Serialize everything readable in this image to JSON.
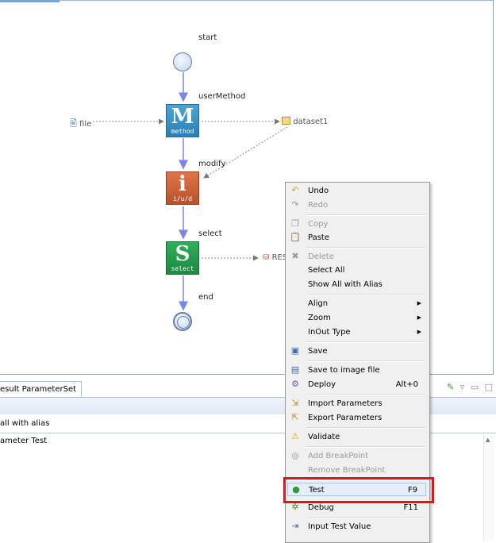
{
  "diagram": {
    "labels": {
      "start": "start",
      "userMethod": "userMethod",
      "modify": "modify",
      "select": "select",
      "end": "end",
      "file": "file",
      "dataset1": "dataset1",
      "res": "RES"
    },
    "nodes": {
      "method": {
        "big": "M",
        "small": "method"
      },
      "iud": {
        "big": "i",
        "small": "i/u/d"
      },
      "select": {
        "big": "S",
        "small": "select"
      }
    }
  },
  "bottom_panel": {
    "tab_label": "esult ParameterSet",
    "row1": "all with alias",
    "row2": "ameter Test"
  },
  "context_menu": {
    "items": [
      {
        "label": "Undo",
        "icon": "undo-icon",
        "disabled": false
      },
      {
        "label": "Redo",
        "icon": "redo-icon",
        "disabled": true
      },
      {
        "label": "Copy",
        "icon": "copy-icon",
        "disabled": true
      },
      {
        "label": "Paste",
        "icon": "paste-icon",
        "disabled": false
      },
      {
        "label": "Delete",
        "icon": "delete-icon",
        "disabled": true
      },
      {
        "label": "Select All",
        "disabled": false
      },
      {
        "label": "Show All with Alias",
        "disabled": false
      },
      {
        "label": "Align",
        "submenu": true
      },
      {
        "label": "Zoom",
        "submenu": true
      },
      {
        "label": "InOut Type",
        "submenu": true
      },
      {
        "label": "Save",
        "icon": "save-icon"
      },
      {
        "label": "Save to image file",
        "icon": "save-image-icon"
      },
      {
        "label": "Deploy",
        "icon": "deploy-icon",
        "shortcut": "Alt+0"
      },
      {
        "label": "Import Parameters",
        "icon": "import-icon"
      },
      {
        "label": "Export Parameters",
        "icon": "export-icon"
      },
      {
        "label": "Validate",
        "icon": "warning-icon"
      },
      {
        "label": "Add BreakPoint",
        "icon": "breakpoint-icon",
        "disabled": true
      },
      {
        "label": "Remove BreakPoint",
        "disabled": true
      },
      {
        "label": "Test",
        "icon": "run-icon",
        "shortcut": "F9",
        "highlighted": true
      },
      {
        "label": "Debug",
        "icon": "debug-icon",
        "shortcut": "F11"
      },
      {
        "label": "Input Test Value",
        "icon": "input-value-icon"
      }
    ]
  },
  "colors": {
    "highlight_box": "#e2151b",
    "flow_arrow": "#7b86e6"
  }
}
